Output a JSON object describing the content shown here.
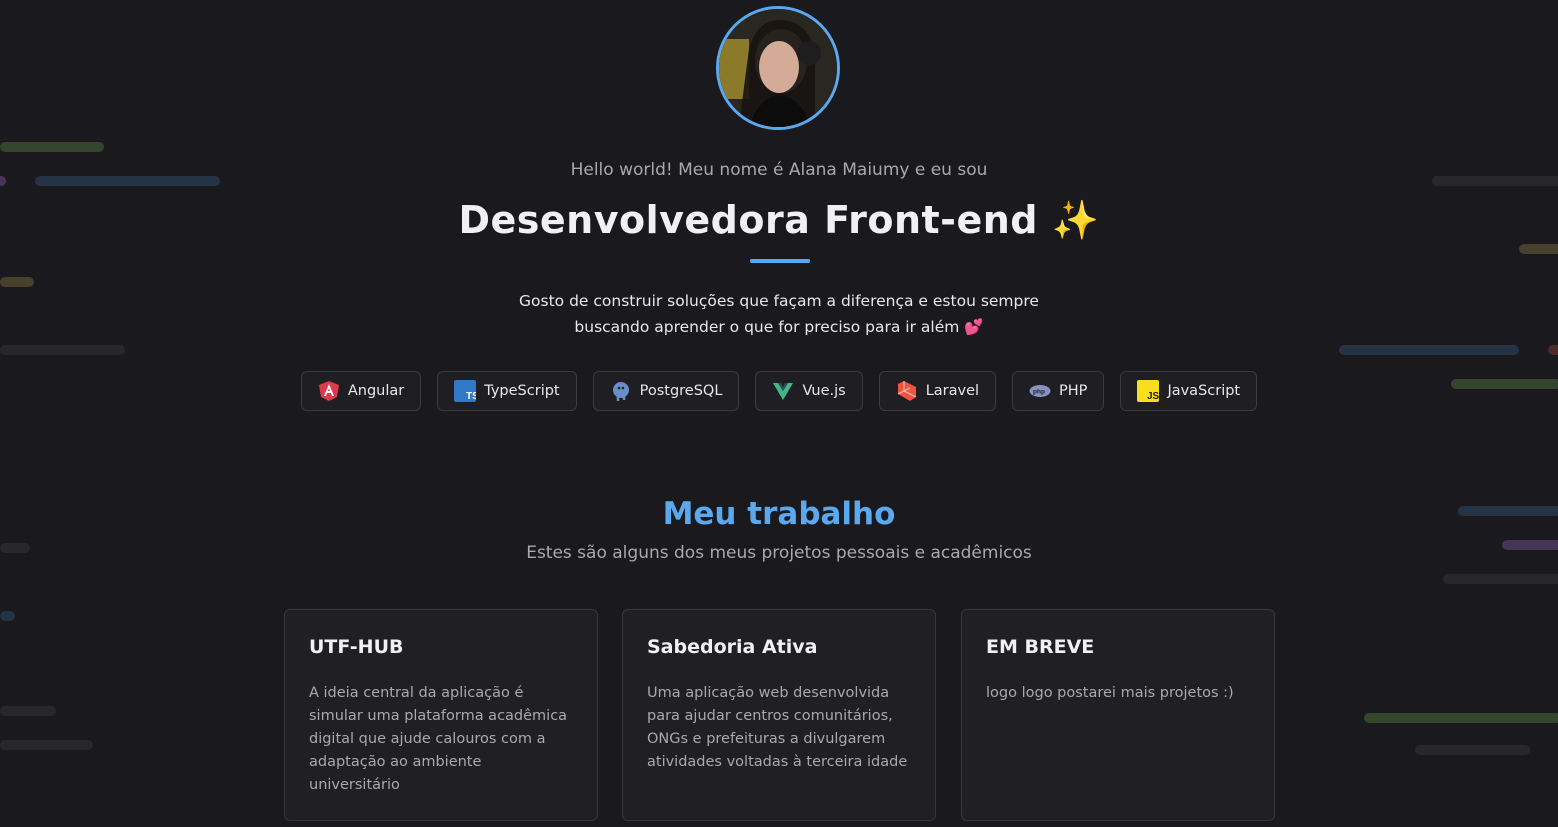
{
  "hero": {
    "greeting": "Hello world! Meu nome é Alana Maiumy e eu sou",
    "headline": "Desenvolvedora Front-end ✨",
    "bio_line1": "Gosto de construir soluções que façam a diferença e estou sempre",
    "bio_line2": "buscando aprender o que for preciso para ir além 💕"
  },
  "techs": [
    {
      "label": "Angular",
      "icon": "angular-icon"
    },
    {
      "label": "TypeScript",
      "icon": "typescript-icon"
    },
    {
      "label": "PostgreSQL",
      "icon": "postgresql-icon"
    },
    {
      "label": "Vue.js",
      "icon": "vue-icon"
    },
    {
      "label": "Laravel",
      "icon": "laravel-icon"
    },
    {
      "label": "PHP",
      "icon": "php-icon"
    },
    {
      "label": "JavaScript",
      "icon": "javascript-icon"
    }
  ],
  "work": {
    "title": "Meu trabalho",
    "subtitle": "Estes são alguns dos meus projetos pessoais e acadêmicos",
    "projects": [
      {
        "title": "UTF-HUB",
        "description": "A ideia central da aplicação é simular uma plataforma acadêmica digital que ajude calouros com a adaptação ao ambiente universitário"
      },
      {
        "title": "Sabedoria Ativa",
        "description": "Uma aplicação web desenvolvida para ajudar centros comunitários, ONGs e prefeituras a divulgarem atividades voltadas à terceira idade"
      },
      {
        "title": "EM BREVE",
        "description": "logo logo postarei mais projetos :)"
      }
    ]
  },
  "colors": {
    "background": "#1a1a1e",
    "accent": "#5aa9ef",
    "card": "#202024"
  }
}
